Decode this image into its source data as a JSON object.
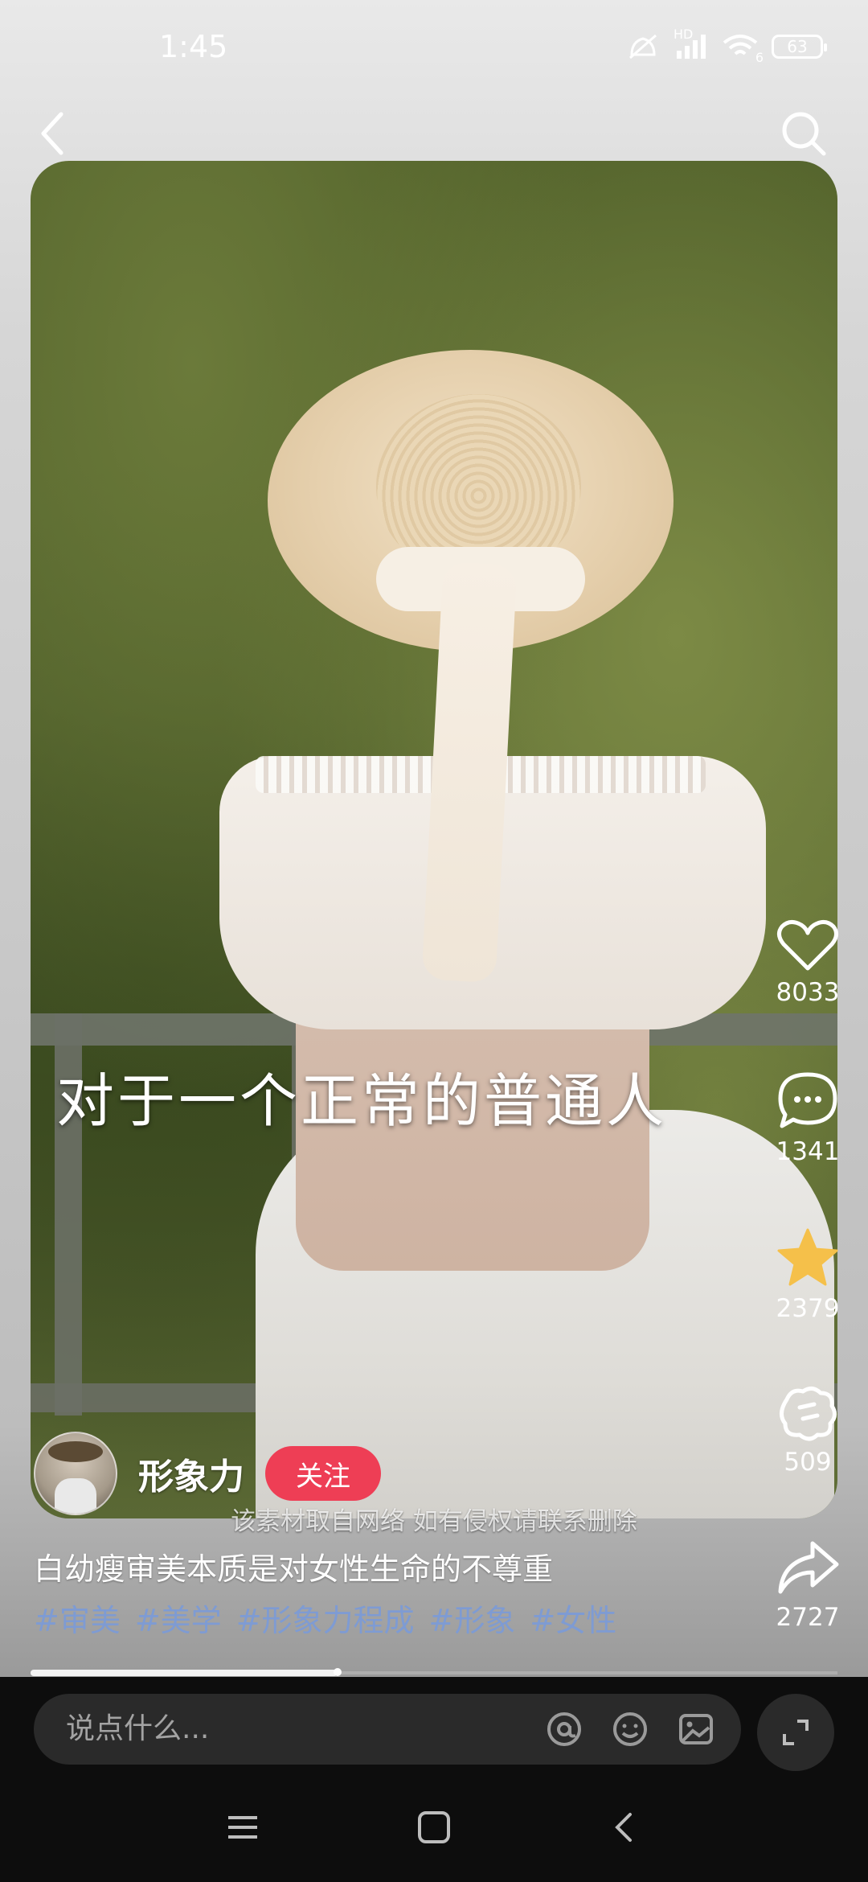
{
  "status_bar": {
    "time": "1:45",
    "signal_label": "HD",
    "wifi_label": "6",
    "battery": "63"
  },
  "overlay_subtitle": "对于一个正常的普通人",
  "watermark": "该素材取自网络 如有侵权请联系删除",
  "author": {
    "name": "形象力",
    "follow_label": "关注"
  },
  "actions": {
    "likes": "8033",
    "comments": "1341",
    "favorites": "2379",
    "gifts": "509",
    "shares": "2727"
  },
  "caption": "白幼瘦审美本质是对女性生命的不尊重",
  "hashtags": [
    "#审美",
    "#美学",
    "#形象力程成",
    "#形象",
    "#女性"
  ],
  "progress": 0.38,
  "comment_bar": {
    "placeholder": "说点什么..."
  },
  "colors": {
    "follow_button": "#ee3e55",
    "hashtag": "#7e9bd3",
    "favorite_star": "#f5c04a"
  },
  "icons": [
    "back-icon",
    "search-icon",
    "heart-icon",
    "comment-icon",
    "star-icon",
    "gift-icon",
    "share-icon",
    "at-icon",
    "emoji-icon",
    "image-icon",
    "expand-icon",
    "menu-icon",
    "home-square-icon",
    "nav-back-icon"
  ]
}
